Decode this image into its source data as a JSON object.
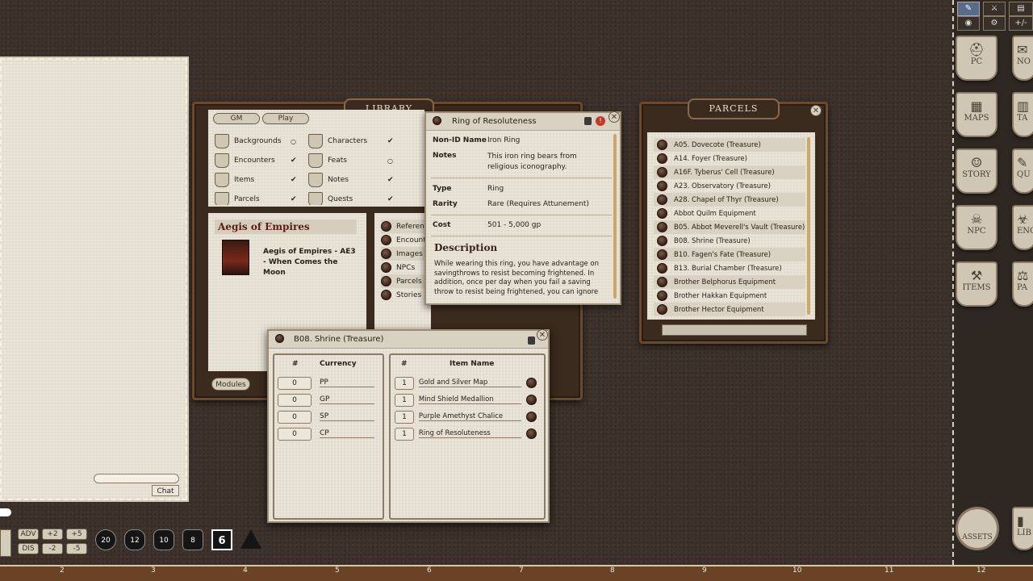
{
  "chat": {
    "tab_label": "Chat"
  },
  "library": {
    "title": "LIBRARY",
    "toggles": [
      "GM",
      "Play"
    ],
    "categories": [
      {
        "label": "Backgrounds",
        "checked": false
      },
      {
        "label": "Characters",
        "checked": true
      },
      {
        "label": "Encounters",
        "checked": true
      },
      {
        "label": "Feats",
        "checked": false
      },
      {
        "label": "Items",
        "checked": true
      },
      {
        "label": "Notes",
        "checked": true
      },
      {
        "label": "Parcels",
        "checked": true
      },
      {
        "label": "Quests",
        "checked": true
      }
    ],
    "module_title": "Aegis of Empires",
    "module_name": "Aegis of Empires - AE3 - When Comes the Moon",
    "sections": [
      "Reference",
      "Encounters",
      "Images",
      "NPCs",
      "Parcels",
      "Stories"
    ],
    "bottom_button": "Modules"
  },
  "item": {
    "title": "Ring of Resoluteness",
    "nonid_label": "Non-ID Name",
    "nonid_value": "Iron Ring",
    "notes_label": "Notes",
    "notes_value": "This iron ring bears from religious iconography.",
    "type_label": "Type",
    "type_value": "Ring",
    "rarity_label": "Rarity",
    "rarity_value": "Rare (Requires Attunement)",
    "cost_label": "Cost",
    "cost_value": "501 - 5,000 gp",
    "desc_heading": "Description",
    "desc_text": "While wearing this ring, you have advantage on savingthrows to resist becoming frightened. In addition, once per day when you fail a saving throw to resist being frightened, you can ignore the condition"
  },
  "parcels": {
    "title": "PARCELS",
    "items": [
      "A05. Dovecote (Treasure)",
      "A14. Foyer (Treasure)",
      "A16F. Tyberus' Cell (Treasure)",
      "A23. Observatory (Treasure)",
      "A28. Chapel of Thyr (Treasure)",
      "Abbot Quilm Equipment",
      "B05. Abbot Meverell's Vault (Treasure)",
      "B08. Shrine (Treasure)",
      "B10. Fagen's Fate (Treasure)",
      "B13. Burial Chamber (Treasure)",
      "Brother Belphorus Equipment",
      "Brother Hakkan Equipment",
      "Brother Hector Equipment"
    ]
  },
  "parcel_window": {
    "title": "B08. Shrine (Treasure)",
    "currency_hash": "#",
    "currency_header": "Currency",
    "currencies": [
      {
        "qty": "0",
        "name": "PP"
      },
      {
        "qty": "0",
        "name": "GP"
      },
      {
        "qty": "0",
        "name": "SP"
      },
      {
        "qty": "0",
        "name": "CP"
      }
    ],
    "items_hash": "#",
    "items_header": "Item Name",
    "items": [
      {
        "qty": "1",
        "name": "Gold and Silver Map"
      },
      {
        "qty": "1",
        "name": "Mind Shield Medallion"
      },
      {
        "qty": "1",
        "name": "Purple Amethyst Chalice"
      },
      {
        "qty": "1",
        "name": "Ring of Resoluteness"
      }
    ]
  },
  "sidebar": {
    "buttons": [
      "PC",
      "MAPS",
      "STORY",
      "NPC",
      "ITEMS"
    ],
    "partial_buttons": [
      "NO",
      "TA",
      "QU",
      "ENC",
      "PA"
    ],
    "assets": "ASSETS",
    "library_partial": "LIB",
    "top_tools": [
      "+/-"
    ]
  },
  "modifiers": {
    "adv": "ADV",
    "dis": "DIS",
    "p2": "+2",
    "p5": "+5",
    "m2": "-2",
    "m5": "-5"
  },
  "dice": [
    "20",
    "12",
    "10",
    "8",
    "6"
  ],
  "ruler": [
    "2",
    "3",
    "4",
    "5",
    "6",
    "7",
    "8",
    "9",
    "10",
    "11",
    "12"
  ]
}
